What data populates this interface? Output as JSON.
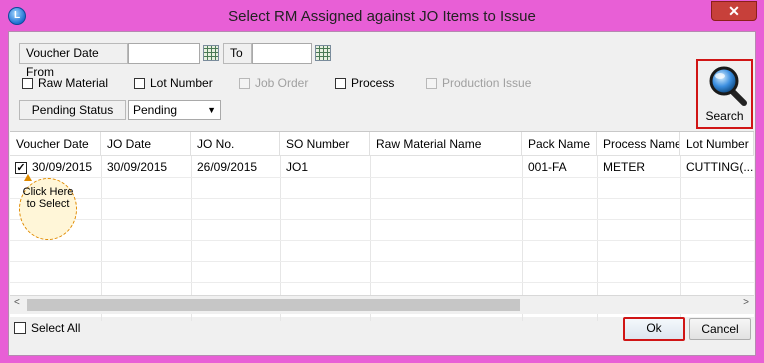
{
  "window": {
    "title": "Select RM Assigned against JO Items to Issue",
    "close": "✕"
  },
  "filters": {
    "voucher_date_from_label": "Voucher Date From",
    "voucher_date_from_value": "",
    "to_label": "To",
    "to_value": "",
    "raw_material": {
      "label": "Raw Material",
      "checked": false
    },
    "lot_number": {
      "label": "Lot Number",
      "checked": false
    },
    "job_order": {
      "label": "Job Order",
      "checked": false,
      "disabled": true
    },
    "process": {
      "label": "Process",
      "checked": false
    },
    "production_issue": {
      "label": "Production Issue",
      "checked": false,
      "disabled": true
    },
    "pending_status_label": "Pending Status",
    "pending_status_value": "Pending"
  },
  "search": {
    "label": "Search",
    "icon": "magnifier-icon"
  },
  "grid": {
    "columns": [
      "Voucher Date",
      "JO Date",
      "JO No.",
      "SO Number",
      "Raw Material Name",
      "Pack Name",
      "Process Name",
      "Lot Number"
    ],
    "rows": [
      {
        "checked": true,
        "cells": [
          "30/09/2015",
          "30/09/2015",
          "26/09/2015",
          "JO1",
          "",
          "001-FA",
          "METER",
          "CUTTING(..."
        ]
      }
    ]
  },
  "callout": {
    "text": "Click Here to Select"
  },
  "footer": {
    "select_all": "Select All",
    "ok": "Ok",
    "cancel": "Cancel"
  },
  "colors": {
    "window_frame": "#e85fd6",
    "highlight": "#d01515",
    "close": "#c7403a"
  }
}
